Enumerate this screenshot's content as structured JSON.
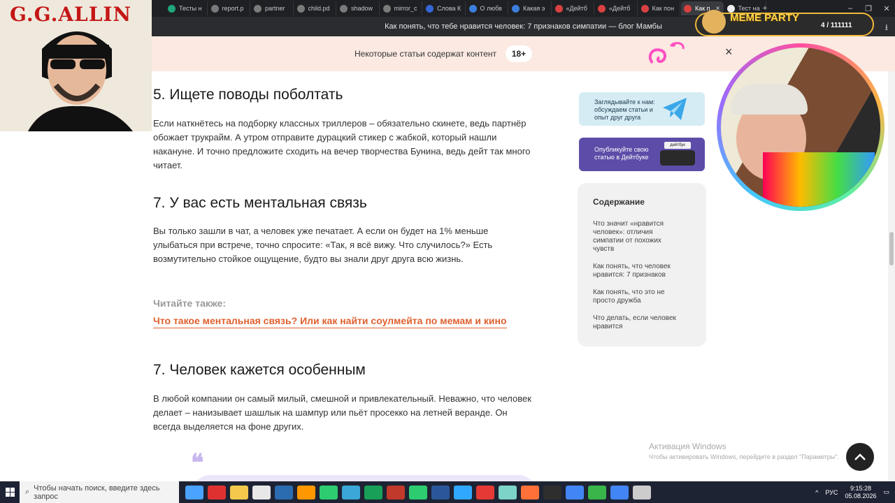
{
  "tabs": [
    "Тесты н",
    "report.p",
    "partner",
    "child.pd",
    "shadow",
    "mirror_c",
    "Слова К",
    "О любв",
    "Какая э",
    "«Дейтб",
    "«Дейтб",
    "Как пон",
    "Как п",
    "Тест на"
  ],
  "tab_colors": [
    "#1fa67a",
    "#7a7a7a",
    "#7a7a7a",
    "#7a7a7a",
    "#7a7a7a",
    "#7a7a7a",
    "#3466d6",
    "#3b7ddd",
    "#3b7ddd",
    "#d94141",
    "#d94141",
    "#d94141",
    "#d94141",
    "#eeeeee"
  ],
  "window": {
    "title": "Как понять, что тебе нравится человек: 7 признаков симпатии — блог Мамбы"
  },
  "banner": {
    "text": "Некоторые статьи содержат контент",
    "badge": "18+",
    "close": "×"
  },
  "article": {
    "h_5": "5. Ищете поводы поболтать",
    "p_5": "Если наткнётесь на подборку классных триллеров – обязательно скинете, ведь партнёр обожает трукрайм. А утром отправите дурацкий стикер с жабкой, который нашли накануне. И точно предложите сходить на вечер творчества Бунина, ведь дейт так много читает.",
    "h_7a": "7. У вас есть ментальная связь",
    "p_7a": "Вы только зашли в чат, а человек уже печатает. А если он будет на 1% меньше улыбаться при встрече, точно спросите: «Так, я всё вижу. Что случилось?» Есть возмутительно стойкое ощущение, будто вы знали друг друга всю жизнь.",
    "read_also": "Читайте также:",
    "read_also_link": "Что такое ментальная связь? Или как найти соулмейта по мемам и кино",
    "h_7b": "7. Человек кажется особенным",
    "p_7b": "В любой компании он самый милый, смешной и привлекательный. Неважно, что человек делает – нанизывает шашлык на шампур или пьёт просекко на летней веранде. Он всегда выделяется на фоне других.",
    "quote_mark": "❝"
  },
  "promos": {
    "telegram": "Заглядывайте к нам: обсуждаем статьи и опыт друг друга",
    "dateybook": "Опубликуйте свою статью в Дейтбуке",
    "dateybook_sign": "дейтбук"
  },
  "toc": {
    "title": "Содержание",
    "items": [
      "Что значит «нравится человек»: отличия симпатии от похожих чувств",
      "Как понять, что человек нравится: 7 признаков",
      "Как понять, что это не просто дружба",
      "Что делать, если человек нравится"
    ]
  },
  "overlay": {
    "gg_title": "G.G.ALLIN",
    "meme_title": "MEME PARTY",
    "meme_count": "4 / 111111"
  },
  "watermark": {
    "line1": "Активация Windows",
    "line2": "Чтобы активировать Windows, перейдите в раздел \"Параметры\"."
  },
  "taskbar": {
    "search_placeholder": "Чтобы начать поиск, введите здесь запрос",
    "lang": "РУС",
    "time": "9:15:28",
    "date": "05.08.2026",
    "icon_colors": [
      "#4aa3ff",
      "#e03131",
      "#f2c94c",
      "#e8e8e8",
      "#2b6cb0",
      "#ff9800",
      "#2ecc71",
      "#3aa7d8",
      "#18a058",
      "#c0392b",
      "#2ecc71",
      "#2b579a",
      "#31a8ff",
      "#e53935",
      "#7dd3c7",
      "#ff7139",
      "#2e2e2e",
      "#4285f4",
      "#39b54a",
      "#4285f4",
      "#cccccc"
    ]
  }
}
